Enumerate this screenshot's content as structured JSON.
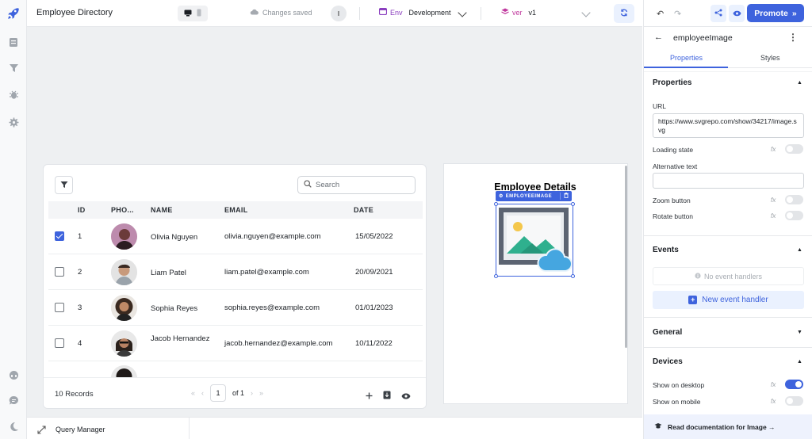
{
  "header": {
    "app_title": "Employee Directory",
    "save_status": "Changes saved",
    "user_initial": "I",
    "env_label": "Env",
    "env_value": "Development",
    "version_label": "ver",
    "version_value": "v1"
  },
  "sidebar": {
    "items": [
      "rocket-logo-icon",
      "pages-icon",
      "queries-icon",
      "debugger-icon",
      "settings-icon"
    ],
    "bottom_items": [
      "chat-icon",
      "comments-icon",
      "theme-icon"
    ]
  },
  "table": {
    "search_placeholder": "Search",
    "columns": [
      "ID",
      "PHO...",
      "NAME",
      "EMAIL",
      "DATE"
    ],
    "rows": [
      {
        "id": "1",
        "name": "Olivia Nguyen",
        "email": "olivia.nguyen@example.com",
        "date": "15/05/2022",
        "checked": true
      },
      {
        "id": "2",
        "name": "Liam Patel",
        "email": "liam.patel@example.com",
        "date": "20/09/2021",
        "checked": false
      },
      {
        "id": "3",
        "name": "Sophia Reyes",
        "email": "sophia.reyes@example.com",
        "date": "01/01/2023",
        "checked": false
      },
      {
        "id": "4",
        "name": "Jacob Hernandez",
        "email": "jacob.hernandez@example.com",
        "date": "10/11/2022",
        "checked": false
      }
    ],
    "records_label": "10 Records",
    "page_number": "1",
    "page_of": "of 1"
  },
  "container": {
    "title": "Employee Details",
    "component_tag": "EMPLOYEEIMAGE"
  },
  "bottom": {
    "query_manager": "Query Manager"
  },
  "panel": {
    "promote_label": "Promote",
    "component_name": "employeeImage",
    "tab_properties": "Properties",
    "tab_styles": "Styles",
    "properties_section": "Properties",
    "url_label": "URL",
    "url_value": "https://www.svgrepo.com/show/34217/image.svg",
    "loading_state": "Loading state",
    "alt_text_label": "Alternative text",
    "zoom_button": "Zoom button",
    "rotate_button": "Rotate button",
    "events_section": "Events",
    "no_event_handlers": "No event handlers",
    "new_event_handler": "New event handler",
    "general_section": "General",
    "devices_section": "Devices",
    "show_desktop": "Show on desktop",
    "show_mobile": "Show on mobile",
    "docs_link": "Read documentation for Image →",
    "fx_label": "fx"
  },
  "colors": {
    "accent": "#3e63dd",
    "env_purple": "#8b3fbf",
    "version_pink": "#c0399e"
  }
}
